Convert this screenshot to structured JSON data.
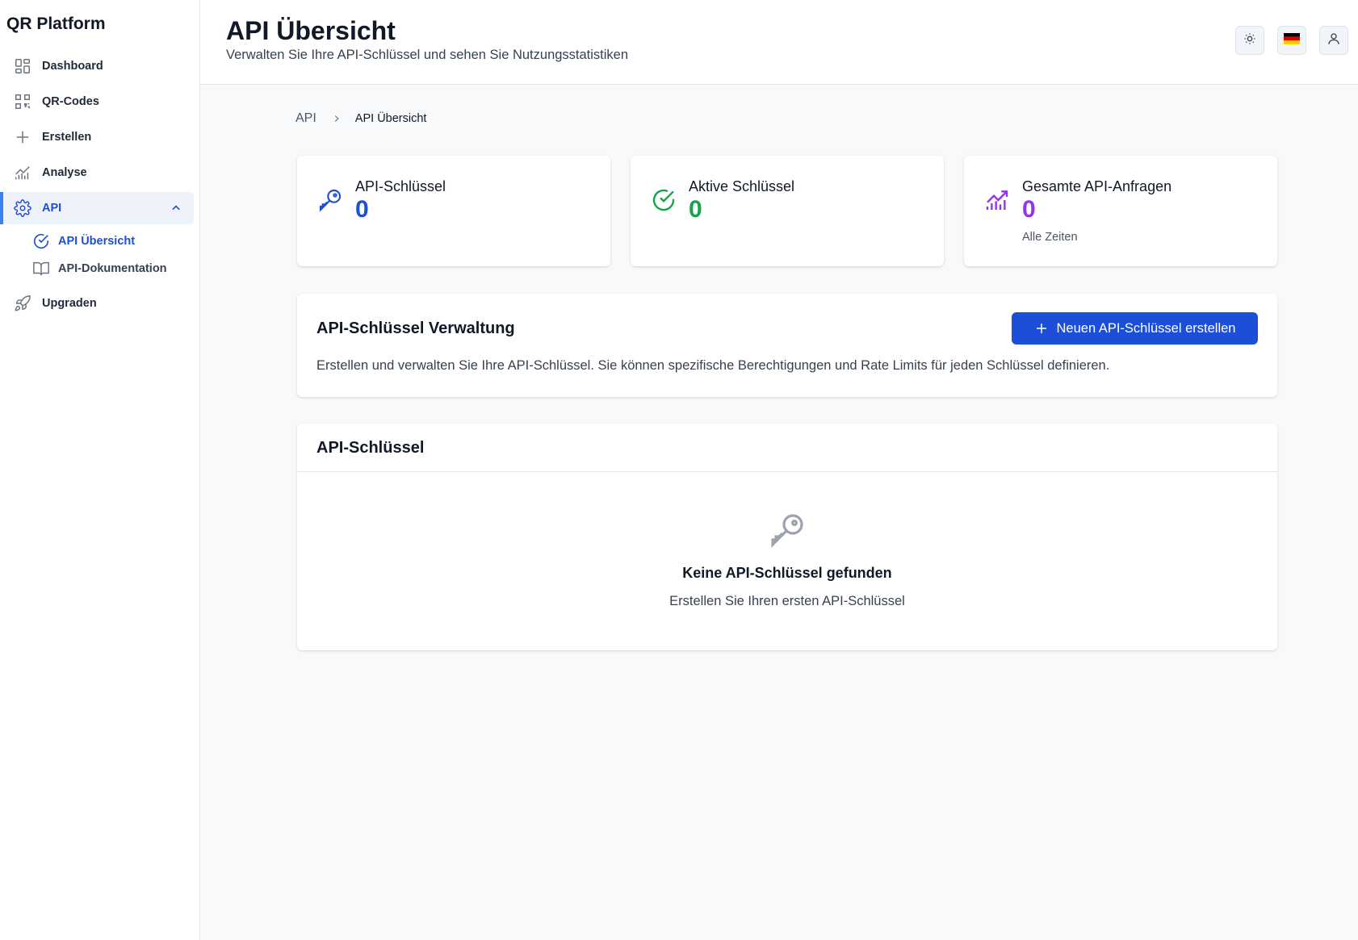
{
  "app": {
    "brand": "QR Platform"
  },
  "sidebar": {
    "items": [
      {
        "label": "Dashboard",
        "icon": "dashboard-grid-icon"
      },
      {
        "label": "QR-Codes",
        "icon": "qr-code-icon"
      },
      {
        "label": "Erstellen",
        "icon": "plus-icon"
      },
      {
        "label": "Analyse",
        "icon": "chart-icon"
      },
      {
        "label": "API",
        "icon": "gear-icon",
        "expanded": true,
        "active": true
      },
      {
        "label": "Upgraden",
        "icon": "rocket-icon"
      }
    ],
    "sub_items": [
      {
        "label": "API Übersicht",
        "icon": "check-circle-icon",
        "active": true
      },
      {
        "label": "API-Dokumentation",
        "icon": "book-icon"
      }
    ]
  },
  "header": {
    "title": "API Übersicht",
    "subtitle": "Verwalten Sie Ihre API-Schlüssel und sehen Sie Nutzungsstatistiken",
    "actions": [
      "sun-icon",
      "german-flag-icon",
      "user-icon"
    ]
  },
  "breadcrumb": {
    "root": "API",
    "current": "API Übersicht"
  },
  "stats": [
    {
      "label": "API-Schlüssel",
      "value": "0",
      "color": "#1d4ed8",
      "icon": "key-icon"
    },
    {
      "label": "Aktive Schlüssel",
      "value": "0",
      "color": "#16a34a",
      "icon": "check-circle-icon"
    },
    {
      "label": "Gesamte API-Anfragen",
      "value": "0",
      "sub": "Alle Zeiten",
      "color": "#9333ea",
      "icon": "chart-up-icon"
    }
  ],
  "management": {
    "title": "API-Schlüssel Verwaltung",
    "description": "Erstellen und verwalten Sie Ihre API-Schlüssel. Sie können spezifische Berechtigungen und Rate Limits für jeden Schlüssel definieren.",
    "create_button": "Neuen API-Schlüssel erstellen"
  },
  "keys": {
    "title": "API-Schlüssel",
    "empty_title": "Keine API-Schlüssel gefunden",
    "empty_subtitle": "Erstellen Sie Ihren ersten API-Schlüssel"
  },
  "colors": {
    "accent": "#1d4ed8",
    "active_bg": "#eef2fb",
    "border": "#e5e7eb"
  }
}
